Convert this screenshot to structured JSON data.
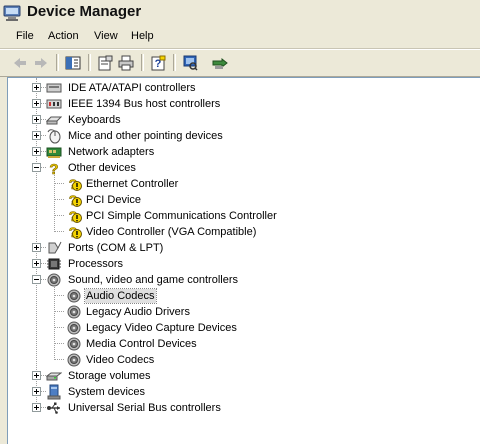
{
  "window": {
    "title": "Device Manager"
  },
  "menu": [
    "File",
    "Action",
    "View",
    "Help"
  ],
  "toolbar": {
    "buttons": [
      "back-icon",
      "forward-icon",
      "show-hide-tree-icon",
      "properties-icon",
      "print-icon",
      "help-icon",
      "scan-hardware-icon",
      "update-driver-icon"
    ]
  },
  "tree": {
    "items": [
      {
        "label": "IDE ATA/ATAPI controllers",
        "icon": "ide-controller-icon",
        "level": 0,
        "expander": "plus"
      },
      {
        "label": "IEEE 1394 Bus host controllers",
        "icon": "ieee1394-icon",
        "level": 0,
        "expander": "plus"
      },
      {
        "label": "Keyboards",
        "icon": "keyboard-icon",
        "level": 0,
        "expander": "plus"
      },
      {
        "label": "Mice and other pointing devices",
        "icon": "mouse-icon",
        "level": 0,
        "expander": "plus"
      },
      {
        "label": "Network adapters",
        "icon": "network-adapter-icon",
        "level": 0,
        "expander": "plus"
      },
      {
        "label": "Other devices",
        "icon": "unknown-device-icon",
        "level": 0,
        "expander": "minus"
      },
      {
        "label": "Ethernet Controller",
        "icon": "warning-device-icon",
        "level": 1
      },
      {
        "label": "PCI Device",
        "icon": "warning-device-icon",
        "level": 1
      },
      {
        "label": "PCI Simple Communications Controller",
        "icon": "warning-device-icon",
        "level": 1
      },
      {
        "label": "Video Controller (VGA Compatible)",
        "icon": "warning-device-icon",
        "level": 1
      },
      {
        "label": "Ports (COM & LPT)",
        "icon": "port-icon",
        "level": 0,
        "expander": "plus"
      },
      {
        "label": "Processors",
        "icon": "processor-icon",
        "level": 0,
        "expander": "plus"
      },
      {
        "label": "Sound, video and game controllers",
        "icon": "speaker-icon",
        "level": 0,
        "expander": "minus"
      },
      {
        "label": "Audio Codecs",
        "icon": "speaker-icon",
        "level": 1,
        "selected": true
      },
      {
        "label": "Legacy Audio Drivers",
        "icon": "speaker-icon",
        "level": 1
      },
      {
        "label": "Legacy Video Capture Devices",
        "icon": "speaker-icon",
        "level": 1
      },
      {
        "label": "Media Control Devices",
        "icon": "speaker-icon",
        "level": 1
      },
      {
        "label": "Video Codecs",
        "icon": "speaker-icon",
        "level": 1
      },
      {
        "label": "Storage volumes",
        "icon": "storage-volume-icon",
        "level": 0,
        "expander": "plus"
      },
      {
        "label": "System devices",
        "icon": "system-device-icon",
        "level": 0,
        "expander": "plus"
      },
      {
        "label": "Universal Serial Bus controllers",
        "icon": "usb-icon",
        "level": 0,
        "expander": "plus"
      }
    ]
  },
  "colors": {
    "chrome": "#ece9d8",
    "tree_bg": "#ffffff",
    "warning": "#f5d400",
    "selection": "#e0e0e0"
  }
}
